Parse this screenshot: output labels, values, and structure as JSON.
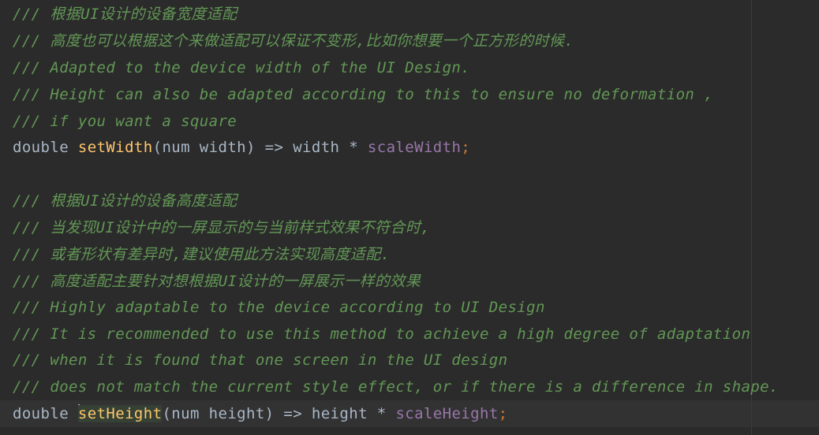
{
  "editor": {
    "block1": {
      "comments": [
        "/// 根据UI设计的设备宽度适配",
        "/// 高度也可以根据这个来做适配可以保证不变形,比如你想要一个正方形的时候.",
        "/// Adapted to the device width of the UI Design.",
        "/// Height can also be adapted according to this to ensure no deformation ,",
        "/// if you want a square"
      ],
      "code": {
        "type_kw": "double",
        "fn_name": "setWidth",
        "params": "(num width) => width * ",
        "field": "scaleWidth",
        "end": ";"
      }
    },
    "block2": {
      "comments": [
        "/// 根据UI设计的设备高度适配",
        "/// 当发现UI设计中的一屏显示的与当前样式效果不符合时,",
        "/// 或者形状有差异时,建议使用此方法实现高度适配.",
        "/// 高度适配主要针对想根据UI设计的一屏展示一样的效果",
        "/// Highly adaptable to the device according to UI Design",
        "/// It is recommended to use this method to achieve a high degree of adaptation",
        "/// when it is found that one screen in the UI design",
        "/// does not match the current style effect, or if there is a difference in shape."
      ],
      "code": {
        "type_kw": "double",
        "fn_name": "setHeight",
        "params": "(num height) => height * ",
        "field": "scaleHeight",
        "end": ";"
      }
    }
  },
  "colors": {
    "background": "#2b2b2b",
    "doc_comment": "#629755",
    "keyword": "#a9b7c6",
    "function": "#ffc66d",
    "field": "#9876aa",
    "punctuation": "#cc7832"
  }
}
